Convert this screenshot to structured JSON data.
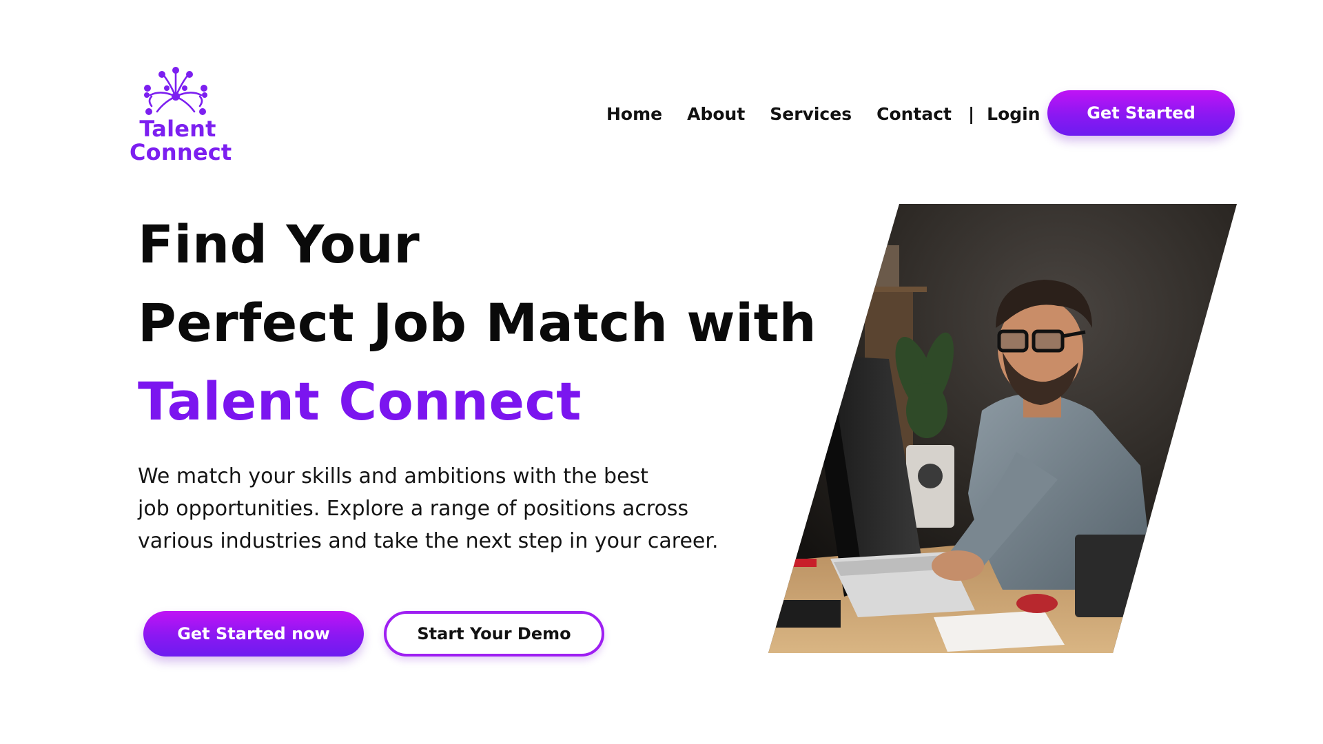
{
  "brand": {
    "name_line1": "Talent",
    "name_line2": "Connect",
    "color": "#7c1ff0",
    "icon": "network-tree-icon"
  },
  "nav": {
    "items": [
      {
        "label": "Home"
      },
      {
        "label": "About"
      },
      {
        "label": "Services"
      },
      {
        "label": "Contact"
      }
    ],
    "separator": "|",
    "login_label": "Login",
    "cta_label": "Get Started"
  },
  "hero": {
    "headline_line1": "Find Your",
    "headline_line2": "Perfect Job Match with",
    "headline_accent": "Talent Connect",
    "description_lines": [
      "We match your skills and ambitions with the best",
      "job opportunities. Explore a range of positions across",
      "various industries and take the next step in your career."
    ],
    "primary_cta": "Get Started now",
    "secondary_cta": "Start Your Demo",
    "image": "man-working-at-computer-photo"
  },
  "colors": {
    "accent": "#7b15ef",
    "gradient_top": "#c013f5",
    "gradient_bottom": "#6d1cf0",
    "outline": "#9e1ff2"
  }
}
